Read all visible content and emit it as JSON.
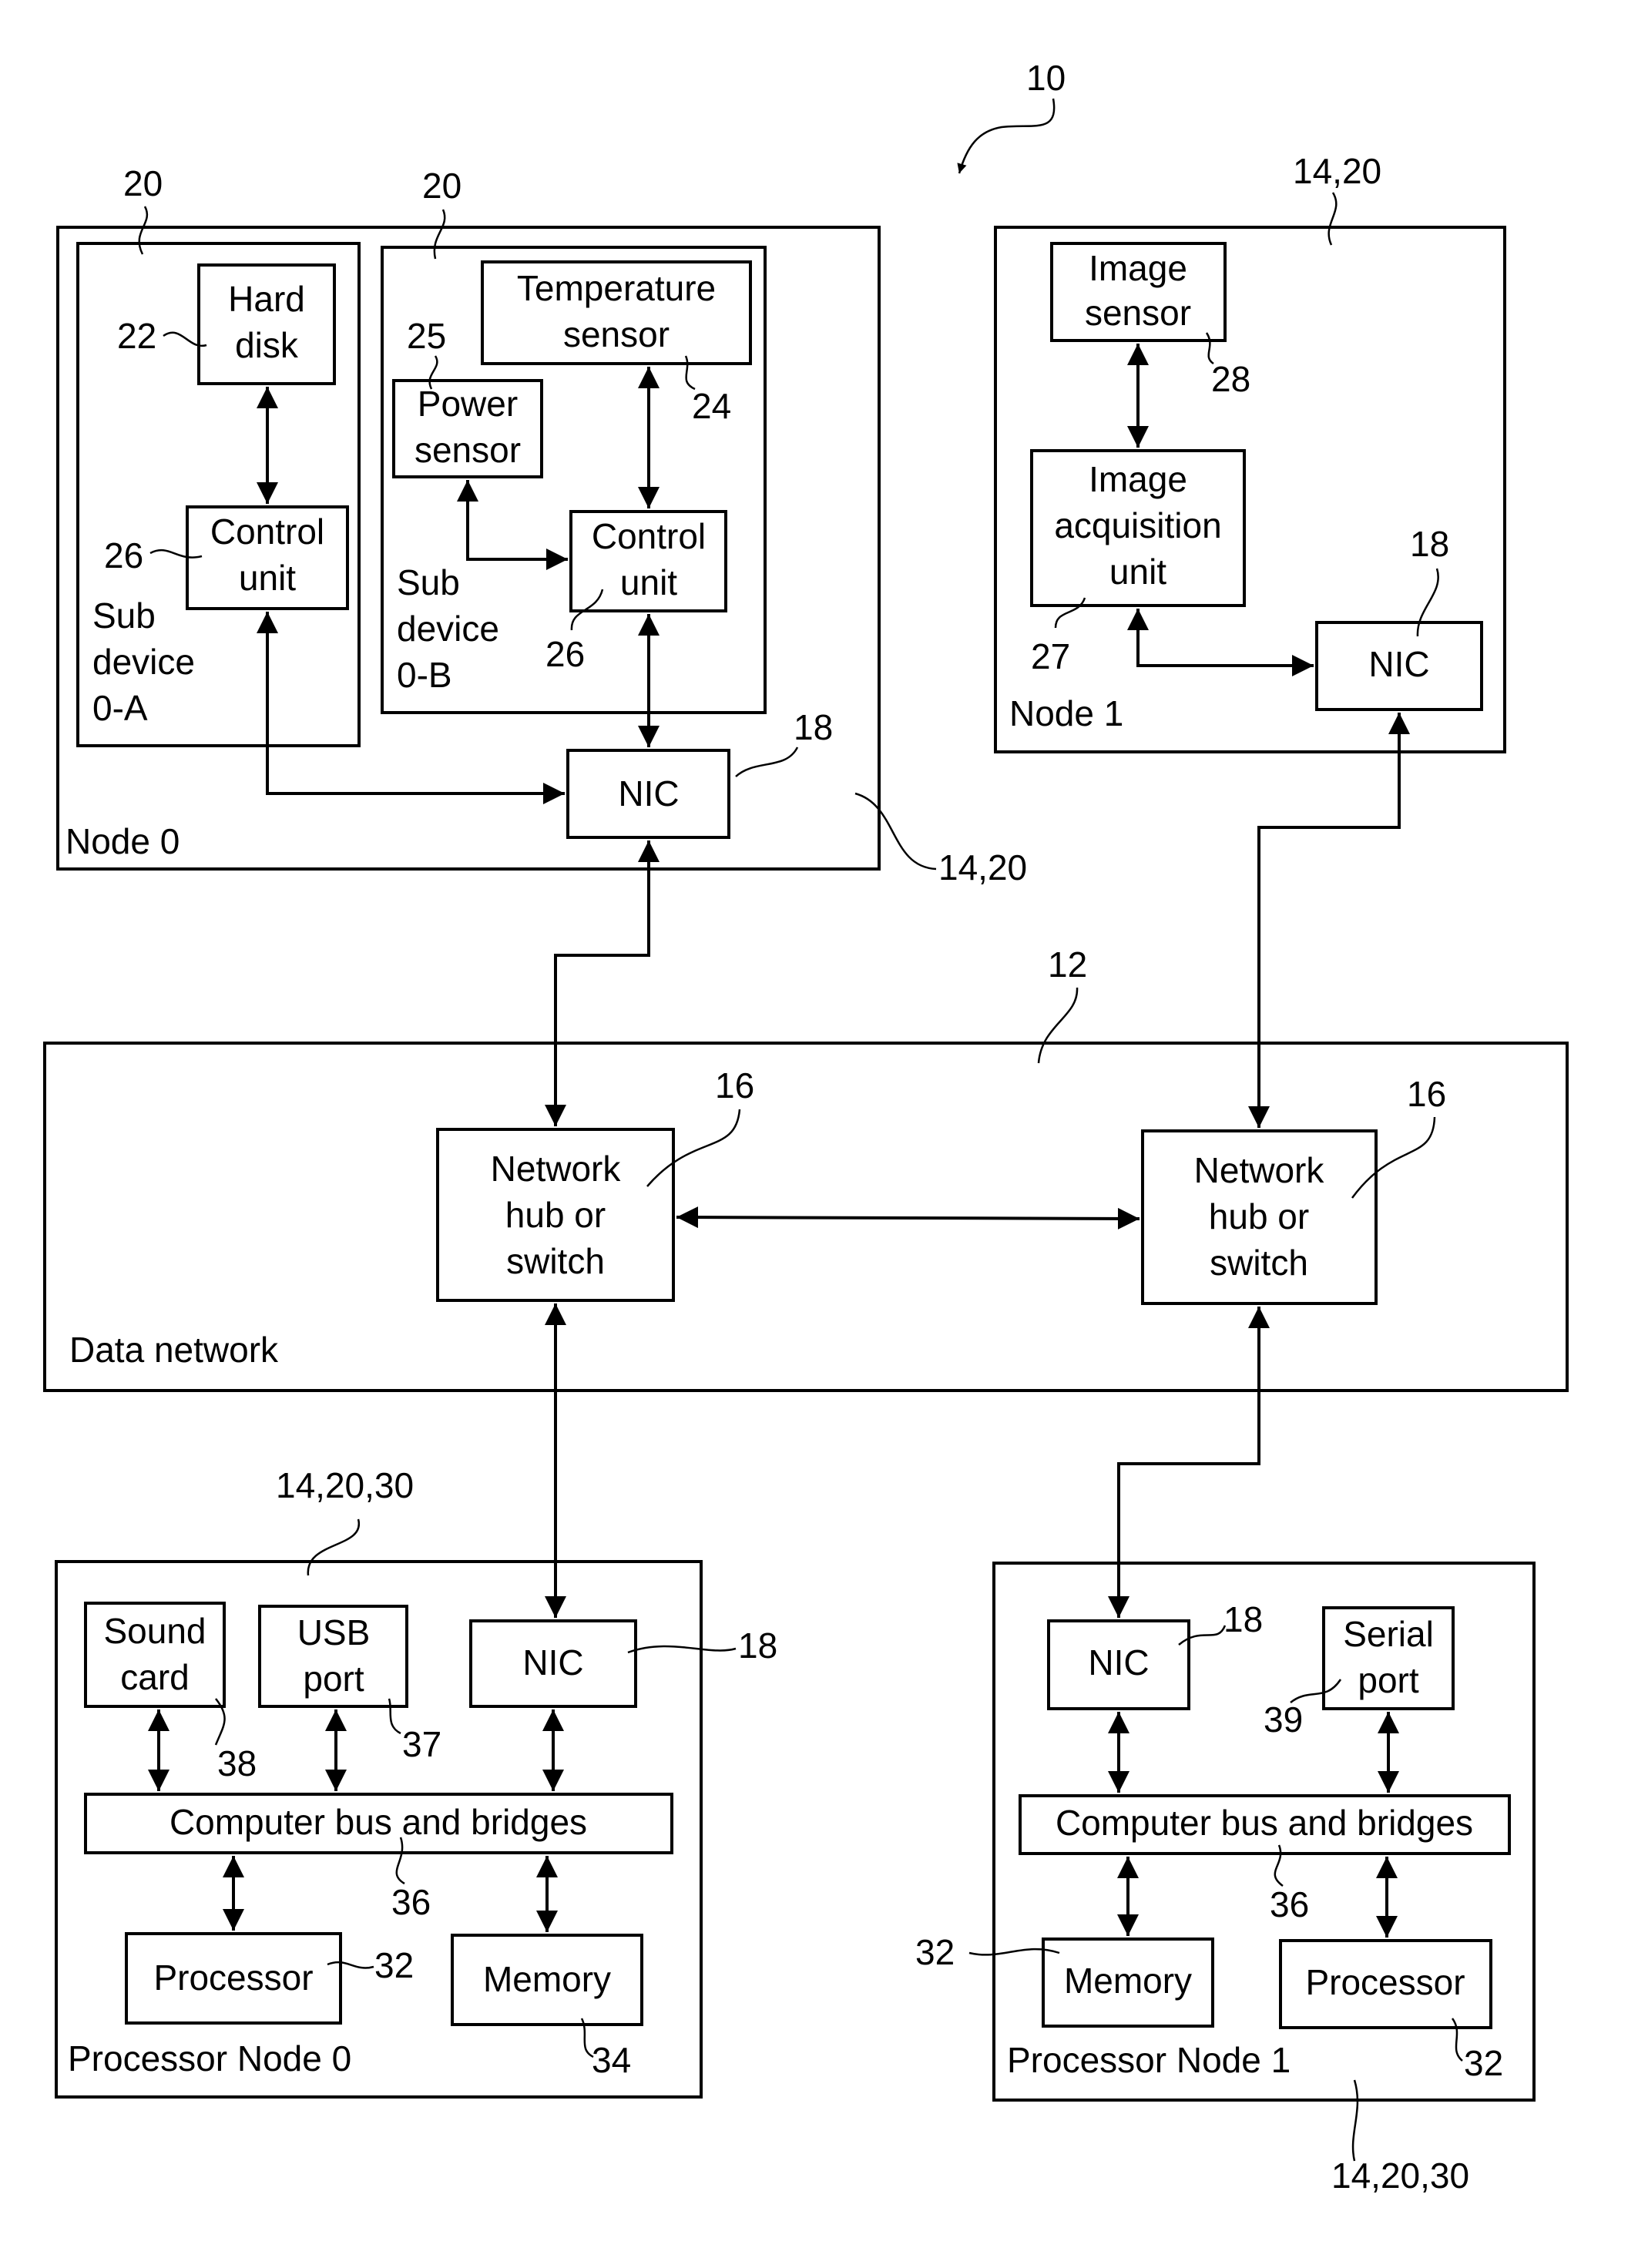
{
  "figure": {
    "ref": "10",
    "data_network": {
      "ref": "12",
      "label": "Data network"
    },
    "hubs": [
      {
        "ref": "16",
        "lines": [
          "Network",
          "hub or",
          "switch"
        ]
      },
      {
        "ref": "16",
        "lines": [
          "Network",
          "hub or",
          "switch"
        ]
      }
    ],
    "node0": {
      "ref": "14,20",
      "label": "Node 0",
      "sub_a": {
        "ref": "20",
        "label_lines": [
          "Sub",
          "device",
          "0-A"
        ],
        "hard_disk": {
          "ref": "22",
          "lines": [
            "Hard",
            "disk"
          ]
        },
        "control": {
          "ref": "26",
          "lines": [
            "Control",
            "unit"
          ]
        }
      },
      "sub_b": {
        "ref": "20",
        "label_lines": [
          "Sub",
          "device",
          "0-B"
        ],
        "temperature": {
          "ref": "24",
          "lines": [
            "Temperature",
            "sensor"
          ]
        },
        "power": {
          "ref": "25",
          "lines": [
            "Power",
            "sensor"
          ]
        },
        "control": {
          "ref": "26",
          "lines": [
            "Control",
            "unit"
          ]
        }
      },
      "nic": {
        "ref": "18",
        "label": "NIC"
      }
    },
    "node1": {
      "ref": "14,20",
      "label": "Node 1",
      "image_sensor": {
        "ref": "28",
        "lines": [
          "Image",
          "sensor"
        ]
      },
      "acquisition": {
        "ref": "27",
        "lines": [
          "Image",
          "acquisition",
          "unit"
        ]
      },
      "nic": {
        "ref": "18",
        "label": "NIC"
      }
    },
    "proc_node0": {
      "ref": "14,20,30",
      "label": "Processor Node 0",
      "sound": {
        "ref": "38",
        "lines": [
          "Sound",
          "card"
        ]
      },
      "usb": {
        "ref": "37",
        "lines": [
          "USB",
          "port"
        ]
      },
      "nic": {
        "ref": "18",
        "label": "NIC"
      },
      "bus": {
        "ref": "36",
        "label": "Computer bus and bridges"
      },
      "processor": {
        "ref": "32",
        "label": "Processor"
      },
      "memory": {
        "ref": "34",
        "label": "Memory"
      }
    },
    "proc_node1": {
      "ref": "14,20,30",
      "label": "Processor Node 1",
      "nic": {
        "ref": "18",
        "label": "NIC"
      },
      "serial": {
        "ref": "39",
        "lines": [
          "Serial",
          "port"
        ]
      },
      "bus": {
        "ref": "36",
        "label": "Computer bus and bridges"
      },
      "memory": {
        "ref": "32",
        "label": "Memory"
      },
      "processor": {
        "ref": "32",
        "label": "Processor"
      }
    }
  }
}
